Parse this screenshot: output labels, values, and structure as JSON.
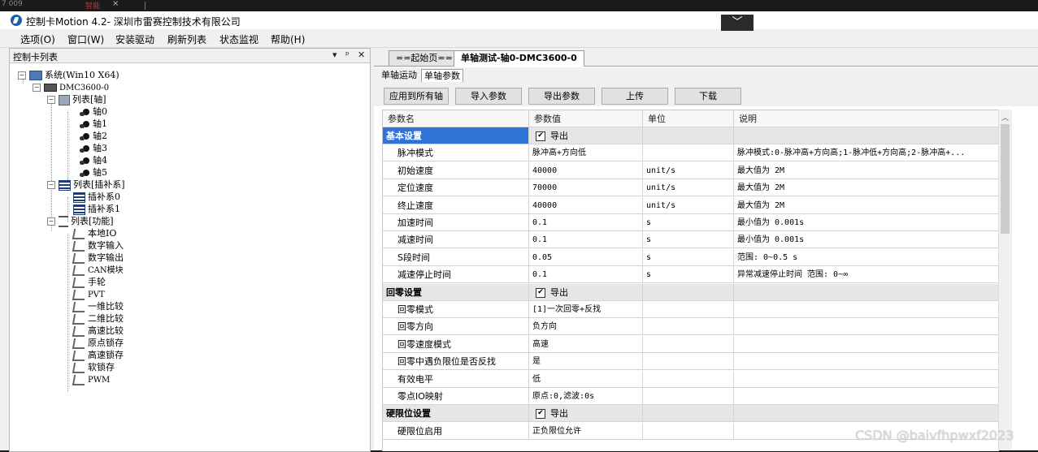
{
  "browser_strip": {
    "tab_text": "7 009",
    "tab_red": "智能",
    "tab_close": "×"
  },
  "title": "控制卡Motion 4.2- 深圳市雷赛控制技术有限公司",
  "title_dropdown": "﹀",
  "menu": [
    "选项(O)",
    "窗口(W)",
    "安装驱动",
    "刷新列表",
    "状态监视",
    "帮助(H)"
  ],
  "left_panel": {
    "title": "控制卡列表",
    "buttons": [
      "▾",
      "ᵖ",
      "✕"
    ],
    "tree": {
      "system": "系统(Win10 X64)",
      "card": "DMC3600-0",
      "axis_list": "列表[轴]",
      "axes": [
        "轴0",
        "轴1",
        "轴2",
        "轴3",
        "轴4",
        "轴5"
      ],
      "interp_list": "列表[插补系]",
      "interps": [
        "插补系0",
        "插补系1"
      ],
      "func_list": "列表[功能]",
      "funcs": [
        "本地IO",
        "数字输入",
        "数字输出",
        "CAN模块",
        "手轮",
        "PVT",
        "一维比较",
        "二维比较",
        "高速比较",
        "原点锁存",
        "高速锁存",
        "软锁存",
        "PWM"
      ]
    }
  },
  "doc_tabs": [
    "==起始页==",
    "单轴测试-轴0-DMC3600-0"
  ],
  "sub_tabs": [
    "单轴运动",
    "单轴参数"
  ],
  "toolbar": [
    "应用到所有轴",
    "导入参数",
    "导出参数",
    "上传",
    "下载"
  ],
  "grid": {
    "headers": [
      "参数名",
      "参数值",
      "单位",
      "说明"
    ],
    "rows": [
      {
        "type": "section",
        "name": "基本设置",
        "check": "✔",
        "value": "导出",
        "selected": true
      },
      {
        "type": "row",
        "name": "脉冲模式",
        "value": "脉冲高+方向低",
        "unit": "",
        "desc": "脉冲模式:0-脉冲高+方向高;1-脉冲低+方向高;2-脉冲高+..."
      },
      {
        "type": "row",
        "name": "初始速度",
        "value": "40000",
        "unit": "unit/s",
        "desc": "最大值为 2M"
      },
      {
        "type": "row",
        "name": "定位速度",
        "value": "70000",
        "unit": "unit/s",
        "desc": "最大值为 2M"
      },
      {
        "type": "row",
        "name": "终止速度",
        "value": "40000",
        "unit": "unit/s",
        "desc": "最大值为 2M"
      },
      {
        "type": "row",
        "name": "加速时间",
        "value": "0.1",
        "unit": "s",
        "desc": "最小值为 0.001s"
      },
      {
        "type": "row",
        "name": "减速时间",
        "value": "0.1",
        "unit": "s",
        "desc": "最小值为 0.001s"
      },
      {
        "type": "row",
        "name": "S段时间",
        "value": "0.05",
        "unit": "s",
        "desc": "范围: 0~0.5 s"
      },
      {
        "type": "row",
        "name": "减速停止时间",
        "value": "0.1",
        "unit": "s",
        "desc": "异常减速停止时间 范围: 0~∞"
      },
      {
        "type": "section",
        "name": "回零设置",
        "check": "✔",
        "value": "导出",
        "selected": false
      },
      {
        "type": "row",
        "name": "回零模式",
        "value": "[1]一次回零+反找",
        "unit": "",
        "desc": ""
      },
      {
        "type": "row",
        "name": "回零方向",
        "value": "负方向",
        "unit": "",
        "desc": ""
      },
      {
        "type": "row",
        "name": "回零速度模式",
        "value": "高速",
        "unit": "",
        "desc": ""
      },
      {
        "type": "row",
        "name": "回零中遇负限位是否反找",
        "value": "是",
        "unit": "",
        "desc": ""
      },
      {
        "type": "row",
        "name": "有效电平",
        "value": "低",
        "unit": "",
        "desc": ""
      },
      {
        "type": "row",
        "name": "零点IO映射",
        "value": "原点:0,滤波:0s",
        "unit": "",
        "desc": ""
      },
      {
        "type": "section",
        "name": "硬限位设置",
        "check": "✔",
        "value": "导出",
        "selected": false
      },
      {
        "type": "row",
        "name": "硬限位启用",
        "value": "正负限位允许",
        "unit": "",
        "desc": ""
      }
    ]
  },
  "scroll_up": "︿",
  "watermark": "CSDN @baivfhpwxf2023"
}
